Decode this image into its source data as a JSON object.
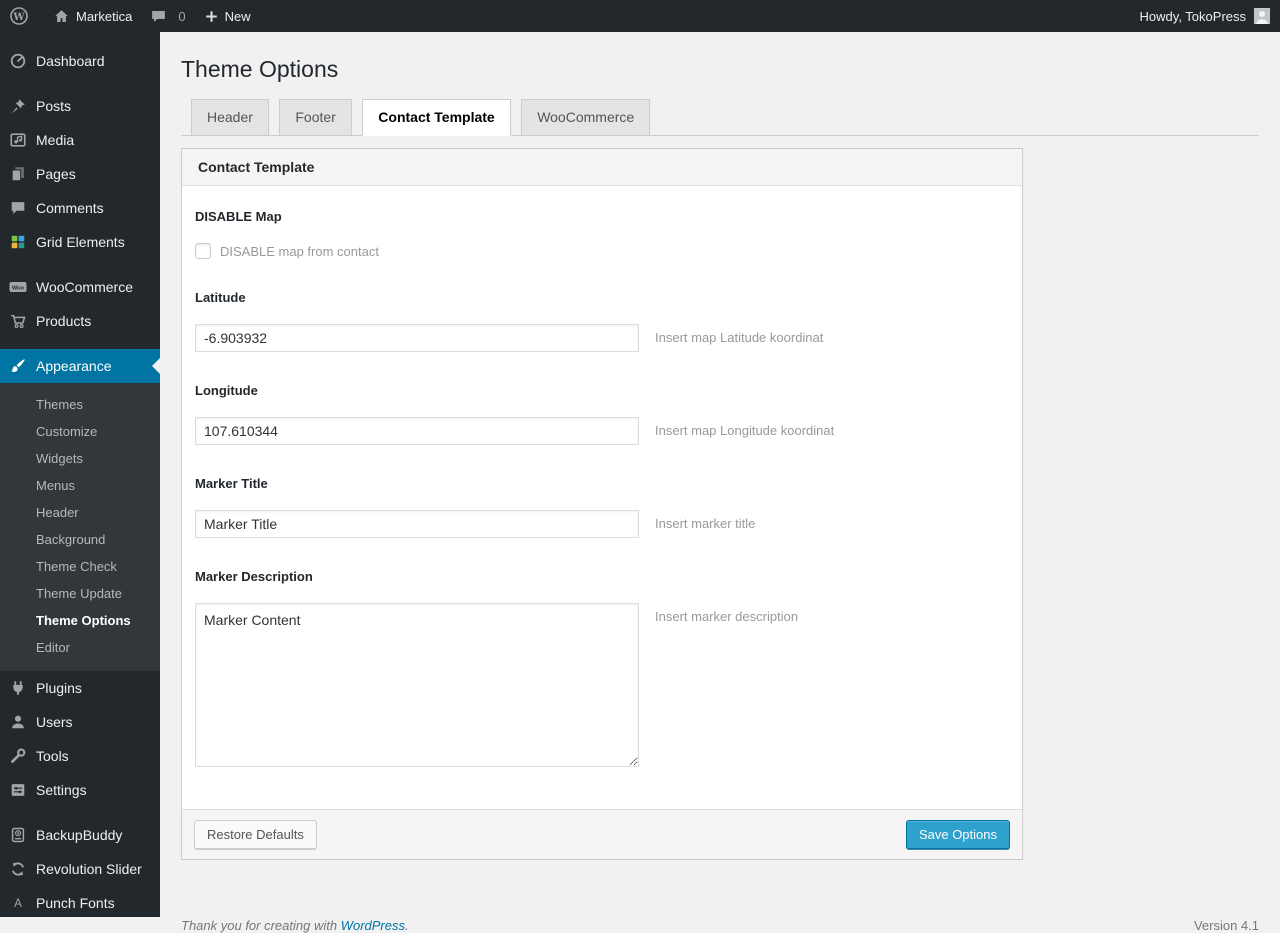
{
  "admin_bar": {
    "site_name": "Marketica",
    "comment_count": "0",
    "new_label": "New",
    "howdy": "Howdy, TokoPress"
  },
  "sidebar": {
    "items": [
      {
        "label": "Dashboard",
        "icon": "dashboard-icon"
      },
      {
        "label": "Posts",
        "icon": "pushpin-icon"
      },
      {
        "label": "Media",
        "icon": "media-icon"
      },
      {
        "label": "Pages",
        "icon": "pages-icon"
      },
      {
        "label": "Comments",
        "icon": "comment-bubble-icon"
      },
      {
        "label": "Grid Elements",
        "icon": "grid-elements-icon"
      },
      {
        "label": "WooCommerce",
        "icon": "woocommerce-icon"
      },
      {
        "label": "Products",
        "icon": "cart-icon"
      },
      {
        "label": "Appearance",
        "icon": "paintbrush-icon",
        "current": true
      },
      {
        "label": "Plugins",
        "icon": "plug-icon"
      },
      {
        "label": "Users",
        "icon": "user-icon"
      },
      {
        "label": "Tools",
        "icon": "wrench-icon"
      },
      {
        "label": "Settings",
        "icon": "sliders-icon"
      },
      {
        "label": "BackupBuddy",
        "icon": "backup-disk-icon"
      },
      {
        "label": "Revolution Slider",
        "icon": "refresh-arrows-icon"
      },
      {
        "label": "Punch Fonts",
        "icon": "letter-a-icon"
      }
    ],
    "appearance_submenu": [
      "Themes",
      "Customize",
      "Widgets",
      "Menus",
      "Header",
      "Background",
      "Theme Check",
      "Theme Update",
      "Theme Options",
      "Editor"
    ],
    "current_submenu_item": "Theme Options"
  },
  "main": {
    "page_title": "Theme Options",
    "tabs": [
      {
        "label": "Header",
        "active": false
      },
      {
        "label": "Footer",
        "active": false
      },
      {
        "label": "Contact Template",
        "active": true
      },
      {
        "label": "WooCommerce",
        "active": false
      }
    ],
    "panel": {
      "title": "Contact Template",
      "fields": {
        "disable_map": {
          "label": "DISABLE Map",
          "checkbox_label": "DISABLE map from contact",
          "checked": false
        },
        "latitude": {
          "label": "Latitude",
          "value": "-6.903932",
          "help": "Insert map Latitude koordinat"
        },
        "longitude": {
          "label": "Longitude",
          "value": "107.610344",
          "help": "Insert map Longitude koordinat"
        },
        "marker_title": {
          "label": "Marker Title",
          "value": "Marker Title",
          "help": "Insert marker title"
        },
        "marker_description": {
          "label": "Marker Description",
          "value": "Marker Content",
          "help": "Insert marker description"
        }
      },
      "restore_button": "Restore Defaults",
      "save_button": "Save Options"
    },
    "footer": {
      "thanks_prefix": "Thank you for creating with ",
      "link_text": "WordPress",
      "thanks_suffix": ".",
      "version": "Version 4.1"
    }
  },
  "colors": {
    "admin_dark": "#23282d",
    "submenu_bg": "#32373c",
    "accent_blue": "#0074a2",
    "primary_button": "#2ea2cc",
    "page_bg": "#f1f1f1"
  }
}
